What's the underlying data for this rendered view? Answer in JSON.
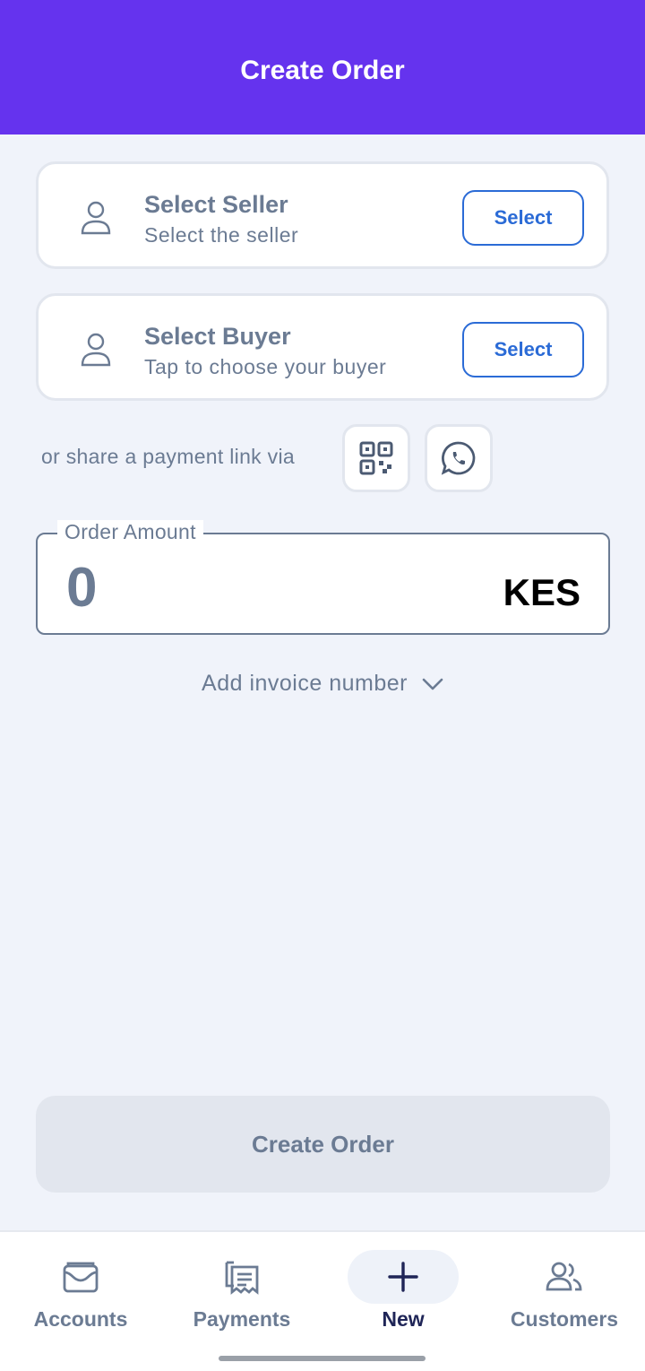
{
  "header": {
    "title": "Create Order"
  },
  "seller": {
    "title": "Select Seller",
    "subtitle": "Select the seller",
    "button": "Select",
    "icon": "person-icon"
  },
  "buyer": {
    "title": "Select Buyer",
    "subtitle": "Tap to choose your buyer",
    "button": "Select",
    "icon": "person-icon"
  },
  "share": {
    "text": "or share a payment link via",
    "icons": [
      "qr-code-icon",
      "whatsapp-icon"
    ]
  },
  "order_amount": {
    "label": "Order Amount",
    "value": "0",
    "currency": "KES"
  },
  "invoice": {
    "label": "Add invoice number",
    "icon": "chevron-down-icon"
  },
  "primary_button": {
    "label": "Create Order"
  },
  "bottom_nav": {
    "items": [
      {
        "label": "Accounts",
        "icon": "wallet-icon"
      },
      {
        "label": "Payments",
        "icon": "receipt-icon"
      },
      {
        "label": "New",
        "icon": "plus-icon",
        "active": true
      },
      {
        "label": "Customers",
        "icon": "people-icon"
      }
    ]
  },
  "colors": {
    "header_bg": "#6533ee",
    "accent": "#2b6bd6",
    "page_bg": "#f0f3fa",
    "muted_text": "#6b7b93",
    "active_nav": "#1f2557"
  }
}
